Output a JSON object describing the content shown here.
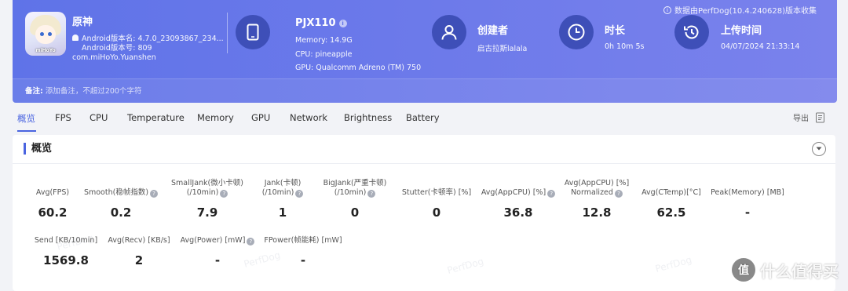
{
  "header": {
    "source_note": "数据由PerfDog(10.4.240628)版本收集",
    "app": {
      "name": "原神",
      "android_version": "Android版本名: 4.7.0_23093867_234...",
      "android_code": "Android版本号: 809",
      "package": "com.miHoYo.Yuanshen",
      "icon_brand": "miHoYo"
    },
    "device": {
      "name": "PJX110",
      "memory": "Memory: 14.9G",
      "cpu": "CPU: pineapple",
      "gpu": "GPU: Qualcomm Adreno (TM) 750"
    },
    "creator": {
      "title": "创建者",
      "value": "启古拉斯lalala"
    },
    "duration": {
      "title": "时长",
      "value": "0h 10m 5s"
    },
    "upload": {
      "title": "上传时间",
      "value": "04/07/2024 21:33:14"
    },
    "remark": {
      "label": "备注:",
      "placeholder": "添加备注，不超过200个字符"
    }
  },
  "tabs": [
    "概览",
    "FPS",
    "CPU",
    "Temperature",
    "Memory",
    "GPU",
    "Network",
    "Brightness",
    "Battery"
  ],
  "active_tab": "概览",
  "export_label": "导出",
  "card": {
    "title": "概览",
    "metrics_row1": [
      {
        "label": "Avg(FPS)",
        "value": "60.2",
        "help": false
      },
      {
        "label": "Smooth(稳帧指数)",
        "value": "0.2",
        "help": true
      },
      {
        "label": "SmallJank(微小卡顿)\n(/10min)",
        "value": "7.9",
        "help": true
      },
      {
        "label": "Jank(卡顿)\n(/10min)",
        "value": "1",
        "help": true
      },
      {
        "label": "BigJank(严重卡顿)\n(/10min)",
        "value": "0",
        "help": true
      },
      {
        "label": "Stutter(卡顿率) [%]",
        "value": "0",
        "help": false
      },
      {
        "label": "Avg(AppCPU) [%]",
        "value": "36.8",
        "help": true
      },
      {
        "label": "Avg(AppCPU) [%]\nNormalized",
        "value": "12.8",
        "help": true
      },
      {
        "label": "Avg(CTemp)[°C]",
        "value": "62.5",
        "help": false
      },
      {
        "label": "Peak(Memory) [MB]",
        "value": "-",
        "help": false
      }
    ],
    "metrics_row2": [
      {
        "label": "Send [KB/10min]",
        "value": "1569.8",
        "help": false
      },
      {
        "label": "Avg(Recv) [KB/s]",
        "value": "2",
        "help": false
      },
      {
        "label": "Avg(Power) [mW]",
        "value": "-",
        "help": true
      },
      {
        "label": "FPower(帧能耗) [mW]",
        "value": "-",
        "help": false
      }
    ]
  },
  "watermark": "PerfDog",
  "corner_logo": {
    "badge": "值",
    "text": "什么值得买"
  },
  "colors": {
    "accent": "#4a64e0",
    "banner_start": "#5f73e8",
    "banner_end": "#7a82ec",
    "icon_circle": "#3e4fb8"
  }
}
